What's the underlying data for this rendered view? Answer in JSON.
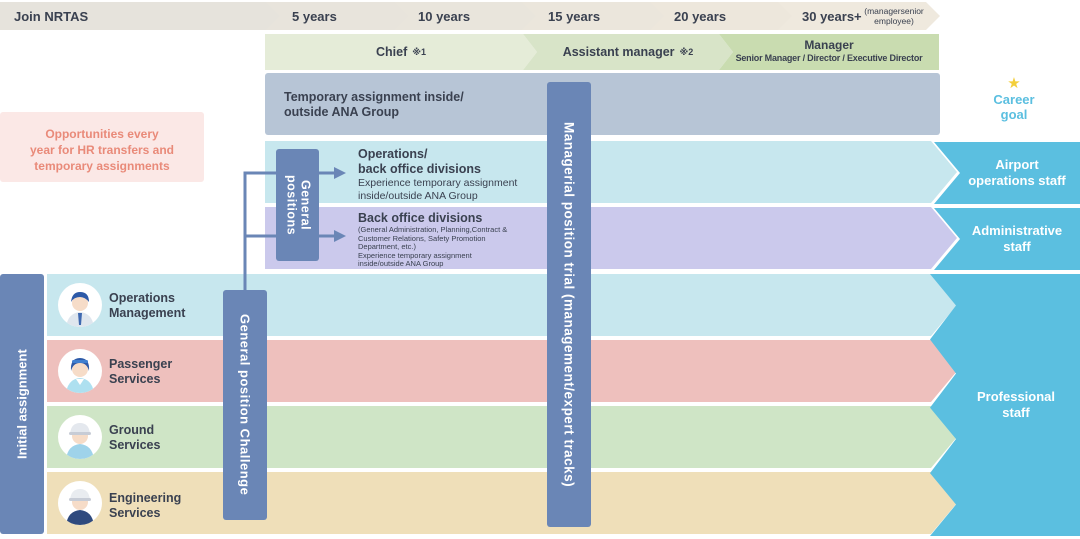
{
  "timeline": {
    "join": "Join NRTAS",
    "steps": [
      "5 years",
      "10 years",
      "15 years",
      "20 years",
      "30 years+"
    ],
    "note": "(managersenior employee)"
  },
  "grades": {
    "chief": "Chief",
    "chief_mark": "※1",
    "assistant": "Assistant manager",
    "assistant_mark": "※2",
    "manager_title": "Manager",
    "manager_sub": "Senior Manager / Director / Executive Director"
  },
  "temporary": {
    "line1": "Temporary assignment inside/",
    "line2": "outside ANA Group"
  },
  "career_goal": {
    "line1": "Career",
    "line2": "goal"
  },
  "opportunities": {
    "line1": "Opportunities every",
    "line2": "year for HR transfers and",
    "line3": "temporary assignments"
  },
  "general_positions": "General positions",
  "operations_backoffice": {
    "title1": "Operations/",
    "title2": "back office divisions",
    "sub1": "Experience temporary assignment",
    "sub2": "inside/outside ANA Group"
  },
  "backoffice": {
    "title": "Back office divisions",
    "d1": "(General Administration, Planning,Contract &",
    "d2": "Customer Relations, Safety Promotion",
    "d3": "Department, etc.)",
    "d4": "Experience temporary assignment",
    "d5": "inside/outside ANA Group"
  },
  "managerial_trial": "Managerial position trial (management/expert tracks)",
  "general_challenge": "General position Challenge",
  "initial_assignment": "Initial assignment",
  "rows": [
    {
      "line1": "Operations",
      "line2": "Management"
    },
    {
      "line1": "Passenger",
      "line2": "Services"
    },
    {
      "line1": "Ground",
      "line2": "Services"
    },
    {
      "line1": "Engineering",
      "line2": "Services"
    }
  ],
  "goals": {
    "airport_line1": "Airport",
    "airport_line2": "operations staff",
    "admin_line1": "Administrative",
    "admin_line2": "staff",
    "pro_line1": "Professional",
    "pro_line2": "staff"
  },
  "colors": {
    "timeline": "#e6e3dc",
    "chief": "#e5ecd8",
    "assistant": "#d8e4c8",
    "manager": "#c9dcb0",
    "temporary": "#b7c5d6",
    "blue_bar": "#6a86b6",
    "operations_band": "#c7e7ee",
    "passenger_band": "#eec0bd",
    "ground_band": "#cfe5c6",
    "engineering_band": "#efdfb9",
    "backoffice_band": "#cbc9ec",
    "goal_blue": "#5bbfe0",
    "opportunities_bg": "#fbe8e6",
    "opportunities_text": "#e98a79",
    "star": "#f3cf3b"
  }
}
